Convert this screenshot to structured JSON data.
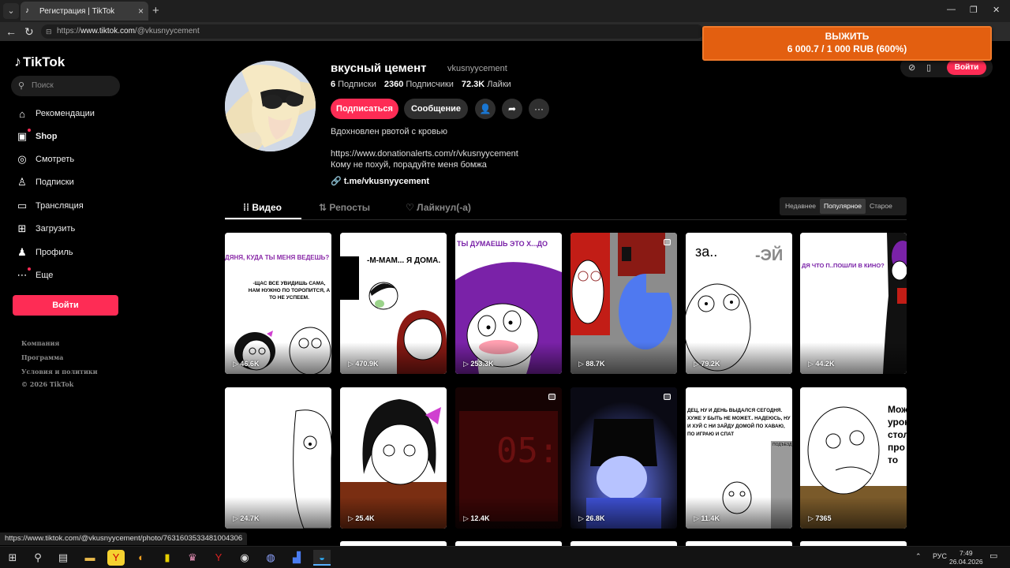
{
  "browser": {
    "tab_title": "Регистрация | TikTok",
    "url_prefix": "https://",
    "url_host": "www.tiktok.com",
    "url_path": "/@vkusnyycement",
    "status_url": "https://www.tiktok.com/@vkusnyycement/photo/7631603533481004306"
  },
  "sidebar": {
    "logo": "TikTok",
    "search_placeholder": "Поиск",
    "items": [
      {
        "label": "Рекомендации"
      },
      {
        "label": "Shop"
      },
      {
        "label": "Смотреть"
      },
      {
        "label": "Подписки"
      },
      {
        "label": "Трансляция"
      },
      {
        "label": "Загрузить"
      },
      {
        "label": "Профиль"
      },
      {
        "label": "Еще"
      }
    ],
    "login_label": "Войти",
    "footer": [
      "Компания",
      "Программа",
      "Условия и политики",
      "© 2026 TikTok"
    ]
  },
  "profile": {
    "name": "вкусный цемент",
    "handle": "vkusnyycement",
    "following_count": "6",
    "following_label": "Подписки",
    "followers_count": "2360",
    "followers_label": "Подписчики",
    "likes_count": "72.3K",
    "likes_label": "Лайки",
    "follow_button": "Подписаться",
    "message_button": "Сообщение",
    "bio_line1": "Вдохновлен рвотой с кровью",
    "bio_line2": "https://www.donationalerts.com/r/vkusnyycement",
    "bio_line3": "Кому не похуй, порадуйте меня бомжа",
    "link": "t.me/vkusnyycement"
  },
  "tabs": {
    "videos": "Видео",
    "reposts": "Репосты",
    "liked": "Лайкнул(-а)"
  },
  "sort": {
    "latest": "Недавнее",
    "popular": "Популярное",
    "oldest": "Старое"
  },
  "videos": [
    {
      "views": "46.6K",
      "caption": "ДЯНЯ, КУДА ТЫ МЕНЯ ВЕДЕШЬ?",
      "caption2": "-ЩАС ВСЕ УВИДИШЬ САМА, НАМ НУЖНО ПО ТОРОПИТСЯ, А ТО НЕ УСПЕЕМ."
    },
    {
      "views": "470.9K",
      "caption": "-М-МАМ... Я ДОМА."
    },
    {
      "views": "253.3K",
      "caption": "ТЫ ДУМАЕШЬ ЭТО Х...ДО"
    },
    {
      "views": "88.7K"
    },
    {
      "views": "79.2K",
      "caption": "за..",
      "caption2": "-ЭЙ"
    },
    {
      "views": "44.2K",
      "caption": "ДЯ ЧТО П..ПОШЛИ В КИНО?"
    },
    {
      "views": "24.7K"
    },
    {
      "views": "25.4K"
    },
    {
      "views": "12.4K",
      "caption": "05:"
    },
    {
      "views": "26.8K"
    },
    {
      "views": "11.4K",
      "caption": "ДЕЦ, НУ И ДЕНЬ ВЫДАЛСЯ СЕГОДНЯ. ХУЖЕ У БЫТЬ НЕ МОЖЕТ.. НАДЕЮСЬ, НУ И ХУЙ С НИ ЗАЙДУ ДОМОЙ ПО ХАВАЮ, ПО ИГРАЮ И СПАТ",
      "caption2": "ПОДЪЕЗД"
    },
    {
      "views": "7365",
      "caption": "Мож урок стол про то"
    }
  ],
  "overlay": {
    "line1": "ВЫЖИТЬ",
    "line2": "6 000.7 / 1 000 RUB (600%)"
  },
  "topright": {
    "login_label": "Войти"
  },
  "taskbar": {
    "lang": "РУС",
    "time": "7:49",
    "date": "26.04.2026"
  }
}
